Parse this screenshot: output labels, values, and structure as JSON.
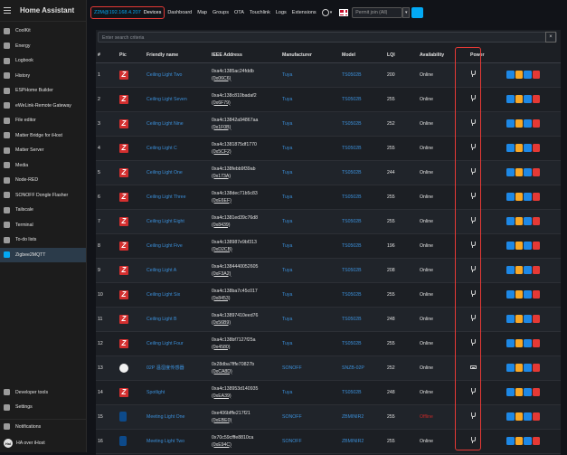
{
  "app": {
    "title": "Home Assistant"
  },
  "sidebar": {
    "items": [
      {
        "label": "CoolKit",
        "icon": "coolkit-icon"
      },
      {
        "label": "Energy",
        "icon": "energy-icon"
      },
      {
        "label": "Logbook",
        "icon": "logbook-icon"
      },
      {
        "label": "History",
        "icon": "history-icon"
      },
      {
        "label": "ESPHome Builder",
        "icon": "esphome-icon"
      },
      {
        "label": "eWeLink-Remote Gateway",
        "icon": "ewelink-icon"
      },
      {
        "label": "File editor",
        "icon": "wrench-icon"
      },
      {
        "label": "Matter Bridge for iHost",
        "icon": "matter-icon"
      },
      {
        "label": "Matter Server",
        "icon": "matter-server-icon"
      },
      {
        "label": "Media",
        "icon": "media-icon"
      },
      {
        "label": "Node-RED",
        "icon": "node-red-icon"
      },
      {
        "label": "SONOFF Dongle Flasher",
        "icon": "flasher-icon"
      },
      {
        "label": "Tailscale",
        "icon": "tailscale-icon"
      },
      {
        "label": "Terminal",
        "icon": "terminal-icon"
      },
      {
        "label": "To-do lists",
        "icon": "todo-icon"
      },
      {
        "label": "Zigbee2MQTT",
        "icon": "zigbee-icon"
      }
    ],
    "bottom": [
      {
        "label": "Developer tools",
        "icon": "hammer-icon"
      },
      {
        "label": "Settings",
        "icon": "gear-icon"
      },
      {
        "label": "Notifications",
        "icon": "bell-icon"
      },
      {
        "label": "HA over iHost",
        "avatar": "HaI"
      }
    ]
  },
  "topbar": {
    "host": "Z2M@192.168.4.207",
    "devices": "Devices",
    "links": [
      "Dashboard",
      "Map",
      "Groups",
      "OTA",
      "Touchlink",
      "Logs",
      "Extensions"
    ],
    "permit_join": "Permit join (All)"
  },
  "search": {
    "placeholder": "Enter search criteria",
    "clear": "×"
  },
  "table": {
    "columns": [
      "#",
      "Pic",
      "Friendly name",
      "IEEE Address",
      "Manufacturer",
      "Model",
      "LQI",
      "Availability",
      "Power"
    ],
    "rows": [
      {
        "n": "1",
        "pic": "z",
        "name": "Ceiling Light Two",
        "ieee": "0xa4c1385ac24fddb",
        "nwk": "(0x06C6)",
        "mfr": "Tuya",
        "model": "TS0502B",
        "lqi": "200",
        "avail": "Online",
        "power": "mains"
      },
      {
        "n": "2",
        "pic": "z",
        "name": "Ceiling Light Seven",
        "ieee": "0xa4c138c810badaf2",
        "nwk": "(0x6F79)",
        "mfr": "Tuya",
        "model": "TS0502B",
        "lqi": "255",
        "avail": "Online",
        "power": "mains"
      },
      {
        "n": "3",
        "pic": "z",
        "name": "Ceiling Light Nine",
        "ieee": "0xa4c13842a94867aa",
        "nwk": "(0x1F0B)",
        "mfr": "Tuya",
        "model": "TS0502B",
        "lqi": "252",
        "avail": "Online",
        "power": "mains"
      },
      {
        "n": "4",
        "pic": "z",
        "name": "Ceiling Light C",
        "ieee": "0xa4c1381875df1770",
        "nwk": "(0x5CF2)",
        "mfr": "Tuya",
        "model": "TS0502B",
        "lqi": "255",
        "avail": "Online",
        "power": "mains"
      },
      {
        "n": "5",
        "pic": "z",
        "name": "Ceiling Light One",
        "ieee": "0xa4c138febb9f39ab",
        "nwk": "(0x173A)",
        "mfr": "Tuya",
        "model": "TS0502B",
        "lqi": "244",
        "avail": "Online",
        "power": "mains"
      },
      {
        "n": "6",
        "pic": "z",
        "name": "Ceiling Light Three",
        "ieee": "0xa4c138dec71b5c83",
        "nwk": "(0xE6EF)",
        "mfr": "Tuya",
        "model": "TS0502B",
        "lqi": "255",
        "avail": "Online",
        "power": "mains"
      },
      {
        "n": "7",
        "pic": "z",
        "name": "Ceiling Light Eight",
        "ieee": "0xa4c1381ed39c76d8",
        "nwk": "(0x8439)",
        "mfr": "Tuya",
        "model": "TS0502B",
        "lqi": "255",
        "avail": "Online",
        "power": "mains"
      },
      {
        "n": "8",
        "pic": "z",
        "name": "Ceiling Light Five",
        "ieee": "0xa4c138987e9bf313",
        "nwk": "(0xD2CB)",
        "mfr": "Tuya",
        "model": "TS0502B",
        "lqi": "196",
        "avail": "Online",
        "power": "mains"
      },
      {
        "n": "9",
        "pic": "z",
        "name": "Ceiling Light A",
        "ieee": "0xa4c1384440052605",
        "nwk": "(0xF3A2)",
        "mfr": "Tuya",
        "model": "TS0502B",
        "lqi": "208",
        "avail": "Online",
        "power": "mains"
      },
      {
        "n": "10",
        "pic": "z",
        "name": "Ceiling Light Six",
        "ieee": "0xa4c138ba7c45c017",
        "nwk": "(0x8453)",
        "mfr": "Tuya",
        "model": "TS0502B",
        "lqi": "255",
        "avail": "Online",
        "power": "mains"
      },
      {
        "n": "11",
        "pic": "z",
        "name": "Ceiling Light B",
        "ieee": "0xa4c13897410eed76",
        "nwk": "(0x56B9)",
        "mfr": "Tuya",
        "model": "TS0502B",
        "lqi": "248",
        "avail": "Online",
        "power": "mains"
      },
      {
        "n": "12",
        "pic": "z",
        "name": "Ceiling Light Four",
        "ieee": "0xa4c138bf7127f25a",
        "nwk": "(0x4580)",
        "mfr": "Tuya",
        "model": "TS0502B",
        "lqi": "255",
        "avail": "Online",
        "power": "mains"
      },
      {
        "n": "13",
        "pic": "ball",
        "name": "02P 温湿度传感器",
        "ieee": "0x28dba7fffe70827b",
        "nwk": "(0xCA8D)",
        "mfr": "SONOFF",
        "model": "SNZB-02P",
        "lqi": "252",
        "avail": "Online",
        "power": "battery"
      },
      {
        "n": "14",
        "pic": "z",
        "name": "Spotlight",
        "ieee": "0xa4c138953d140935",
        "nwk": "(0xEA39)",
        "mfr": "Tuya",
        "model": "TS0502B",
        "lqi": "248",
        "avail": "Online",
        "power": "mains"
      },
      {
        "n": "15",
        "pic": "dongle",
        "name": "Meeting Light One",
        "ieee": "0xe406bfffe217f21",
        "nwk": "(0xEBE0)",
        "mfr": "SONOFF",
        "model": "ZBMINIR2",
        "lqi": "255",
        "avail": "Offline",
        "power": "mains"
      },
      {
        "n": "16",
        "pic": "dongle",
        "name": "Meeting Light Two",
        "ieee": "0x70c59cfffe8810ca",
        "nwk": "(0xE94C)",
        "mfr": "SONOFF",
        "model": "ZBMINIR2",
        "lqi": "255",
        "avail": "Online",
        "power": "mains"
      }
    ]
  },
  "colors": {
    "accent": "#03a9f4",
    "highlight": "#e53935",
    "link": "#3b8fd9",
    "offline": "#c62828"
  }
}
